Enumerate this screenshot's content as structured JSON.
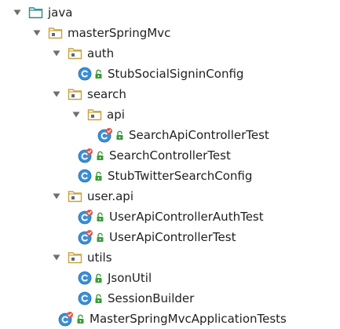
{
  "tree": {
    "nodes": [
      {
        "name": "tree-node-java",
        "label": "java",
        "kind": "source-root",
        "depth": 0,
        "expanded": true
      },
      {
        "name": "tree-node-masterspringmvc",
        "label": "masterSpringMvc",
        "kind": "package",
        "depth": 1,
        "expanded": true
      },
      {
        "name": "tree-node-auth",
        "label": "auth",
        "kind": "package",
        "depth": 2,
        "expanded": true
      },
      {
        "name": "tree-node-stubsocialsigninconfig",
        "label": "StubSocialSigninConfig",
        "kind": "class",
        "depth": 3
      },
      {
        "name": "tree-node-search",
        "label": "search",
        "kind": "package",
        "depth": 2,
        "expanded": true
      },
      {
        "name": "tree-node-api",
        "label": "api",
        "kind": "package",
        "depth": 3,
        "expanded": true
      },
      {
        "name": "tree-node-searchapicontrollertest",
        "label": "SearchApiControllerTest",
        "kind": "test-class",
        "depth": 4
      },
      {
        "name": "tree-node-searchcontrollertest",
        "label": "SearchControllerTest",
        "kind": "test-class",
        "depth": 3
      },
      {
        "name": "tree-node-stubtwittersearchconfig",
        "label": "StubTwitterSearchConfig",
        "kind": "class",
        "depth": 3
      },
      {
        "name": "tree-node-user-api",
        "label": "user.api",
        "kind": "package",
        "depth": 2,
        "expanded": true
      },
      {
        "name": "tree-node-userapicontrollerauthtest",
        "label": "UserApiControllerAuthTest",
        "kind": "test-class",
        "depth": 3
      },
      {
        "name": "tree-node-userapicontrollertest",
        "label": "UserApiControllerTest",
        "kind": "test-class",
        "depth": 3
      },
      {
        "name": "tree-node-utils",
        "label": "utils",
        "kind": "package",
        "depth": 2,
        "expanded": true
      },
      {
        "name": "tree-node-jsonutil",
        "label": "JsonUtil",
        "kind": "class",
        "depth": 3
      },
      {
        "name": "tree-node-sessionbuilder",
        "label": "SessionBuilder",
        "kind": "class",
        "depth": 3
      },
      {
        "name": "tree-node-masterspringmvcapplicationtests",
        "label": "MasterSpringMvcApplicationTests",
        "kind": "test-class",
        "depth": 2
      }
    ]
  },
  "icons": {
    "expand_arrow": "triangle-down-icon",
    "source_root": "source-folder-icon",
    "package": "package-folder-icon",
    "class": "class-c-icon",
    "test_class": "test-class-icon",
    "access": "lock-icon"
  },
  "colors": {
    "arrow": "#6e6e6e",
    "source_folder": "#2b8a8a",
    "package_folder": "#c9a23c",
    "class_badge": "#3a8fd6",
    "test_badge": "#e0574a",
    "lock": "#3a9a3a",
    "text": "#1f1f1f"
  }
}
